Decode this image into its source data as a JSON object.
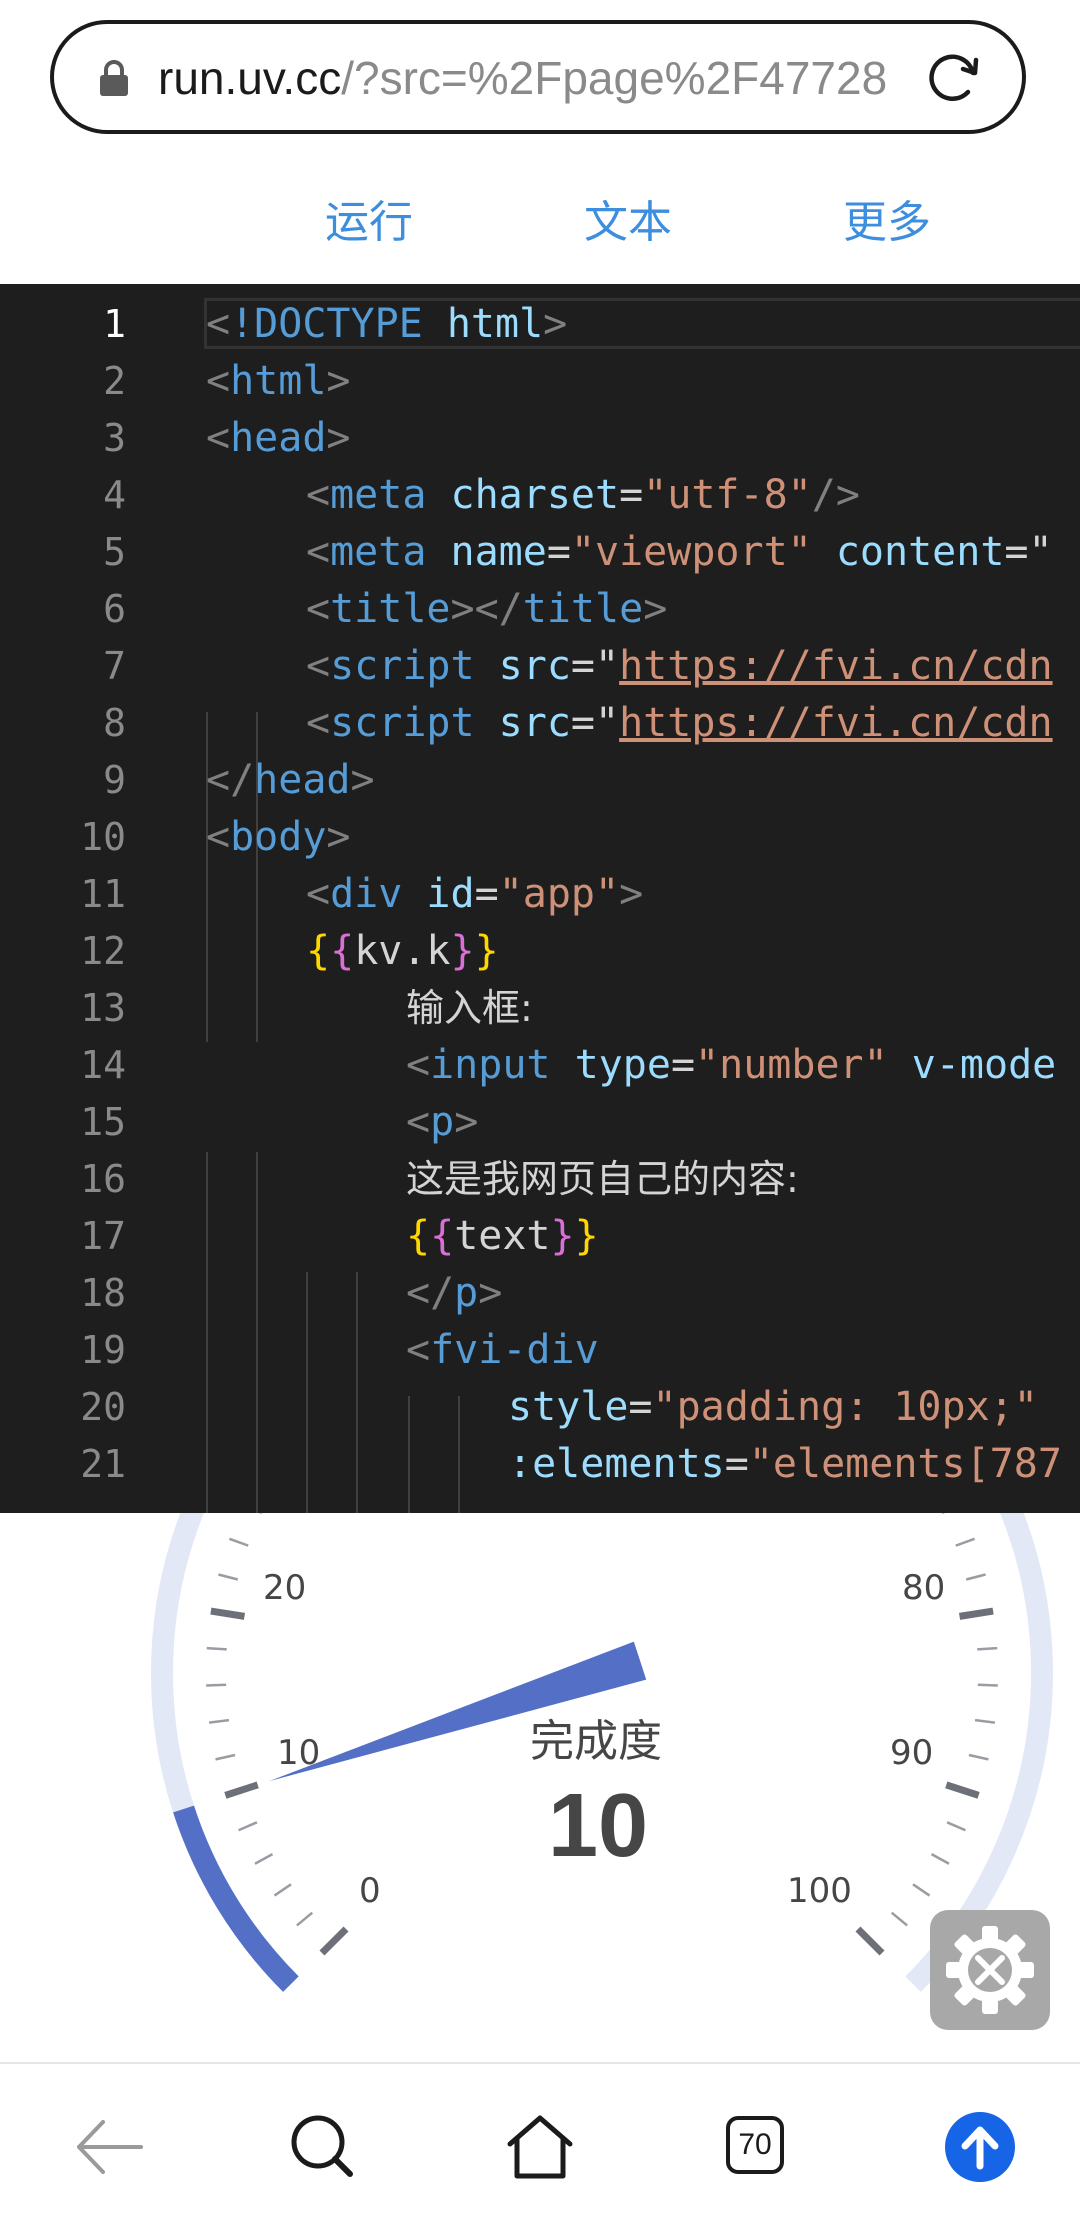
{
  "browser": {
    "url_domain": "run.uv.cc",
    "url_rest": "/?src=%2Fpage%2F47728",
    "tabs_count": "70"
  },
  "tabs": {
    "run": "运行",
    "text": "文本",
    "more": "更多"
  },
  "editor": {
    "active_line": 1,
    "lines": [
      {
        "n": "1",
        "indent": 0
      },
      {
        "n": "2",
        "indent": 0
      },
      {
        "n": "3",
        "indent": 0
      },
      {
        "n": "4",
        "indent": 1
      },
      {
        "n": "5",
        "indent": 1
      },
      {
        "n": "6",
        "indent": 1
      },
      {
        "n": "7",
        "indent": 1
      },
      {
        "n": "8",
        "indent": 1
      },
      {
        "n": "9",
        "indent": 0
      },
      {
        "n": "10",
        "indent": 0
      },
      {
        "n": "11",
        "indent": 1
      },
      {
        "n": "12",
        "indent": 1
      },
      {
        "n": "13",
        "indent": 2
      },
      {
        "n": "14",
        "indent": 2
      },
      {
        "n": "15",
        "indent": 2
      },
      {
        "n": "16",
        "indent": 2
      },
      {
        "n": "17",
        "indent": 2
      },
      {
        "n": "18",
        "indent": 2
      },
      {
        "n": "19",
        "indent": 2
      },
      {
        "n": "20",
        "indent": 3
      },
      {
        "n": "21",
        "indent": 3
      }
    ],
    "text": {
      "l1_doctype": "!DOCTYPE",
      "l1_html": " html",
      "l2_html": "html",
      "l3_head": "head",
      "meta": "meta",
      "charset": " charset",
      "utf8": "\"utf-8\"",
      "name": " name",
      "viewport": "\"viewport\"",
      "content": " content",
      "title": "title",
      "script": "script",
      "src": " src",
      "cdn_url": "https://fvi.cn/cdn",
      "body": "body",
      "div": "div",
      "id": " id",
      "app": "\"app\"",
      "kvk": "kv.k",
      "label_input": "输入框:",
      "input": "input",
      "type": " type",
      "number": "\"number\"",
      "vmodel": " v-mode",
      "p": "p",
      "own_content": "这是我网页自己的内容:",
      "text_var": "text",
      "fvidiv": "fvi-div",
      "style": "style",
      "padding": "\"padding: 10px;\"",
      "elements_attr": ":elements",
      "elements_val": "\"elements[787"
    }
  },
  "gauge": {
    "title": "完成度",
    "value": 10,
    "value_label": "10",
    "min": 0,
    "max": 100,
    "tick_labels": [
      "0",
      "10",
      "20",
      "80",
      "90",
      "100"
    ],
    "accent_color": "#5470c6",
    "track_color": "#e2e8f6"
  },
  "nav": {
    "icons": [
      "back-arrow-icon",
      "search-icon",
      "home-icon",
      "tabs-count-icon",
      "upload-icon"
    ]
  }
}
